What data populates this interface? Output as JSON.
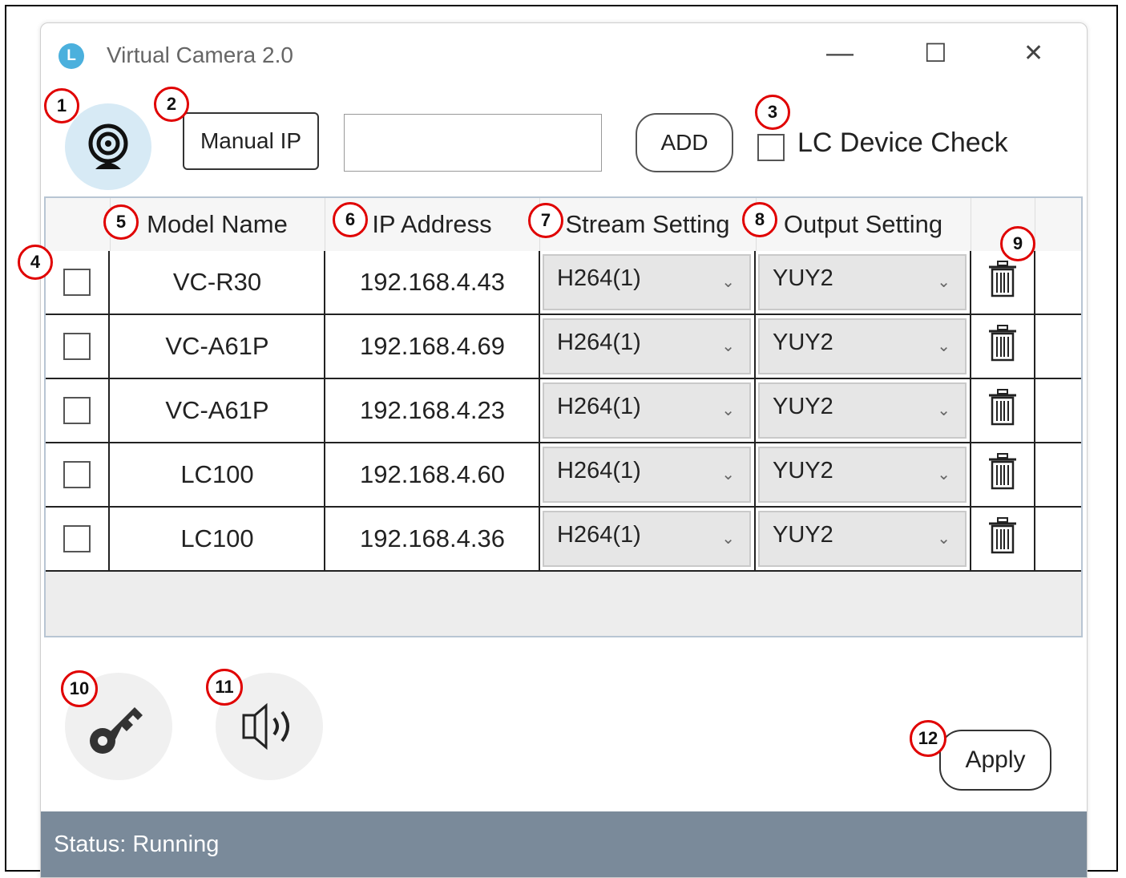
{
  "window": {
    "title": "Virtual Camera 2.0",
    "logo_letter": "L",
    "minimize_glyph": "—",
    "maximize_glyph": "☐",
    "close_glyph": "✕"
  },
  "toolbar": {
    "manual_ip_label": "Manual IP",
    "ip_input_value": "",
    "add_label": "ADD",
    "lc_device_check_label": "LC Device Check",
    "lc_device_check_checked": false
  },
  "table": {
    "headers": [
      "Model Name",
      "IP Address",
      "Stream Setting",
      "Output Setting"
    ],
    "rows": [
      {
        "model": "VC-R30",
        "ip": "192.168.4.43",
        "stream": "H264(1)",
        "output": "YUY2"
      },
      {
        "model": "VC-A61P",
        "ip": "192.168.4.69",
        "stream": "H264(1)",
        "output": "YUY2"
      },
      {
        "model": "VC-A61P",
        "ip": "192.168.4.23",
        "stream": "H264(1)",
        "output": "YUY2"
      },
      {
        "model": "LC100",
        "ip": "192.168.4.60",
        "stream": "H264(1)",
        "output": "YUY2"
      },
      {
        "model": "LC100",
        "ip": "192.168.4.36",
        "stream": "H264(1)",
        "output": "YUY2"
      }
    ]
  },
  "footer": {
    "apply_label": "Apply",
    "status_text": "Status: Running"
  },
  "icons": {
    "camera": "camera-icon",
    "key": "key-icon",
    "speaker": "speaker-icon",
    "trash": "trash-icon"
  },
  "annotations": [
    "1",
    "2",
    "3",
    "4",
    "5",
    "6",
    "7",
    "8",
    "9",
    "10",
    "11",
    "12"
  ],
  "colors": {
    "annotation_ring": "#e00000",
    "status_bar": "#7a8a9a",
    "camera_button_bg": "#d7eaf5",
    "logo": "#4bb0dd"
  }
}
